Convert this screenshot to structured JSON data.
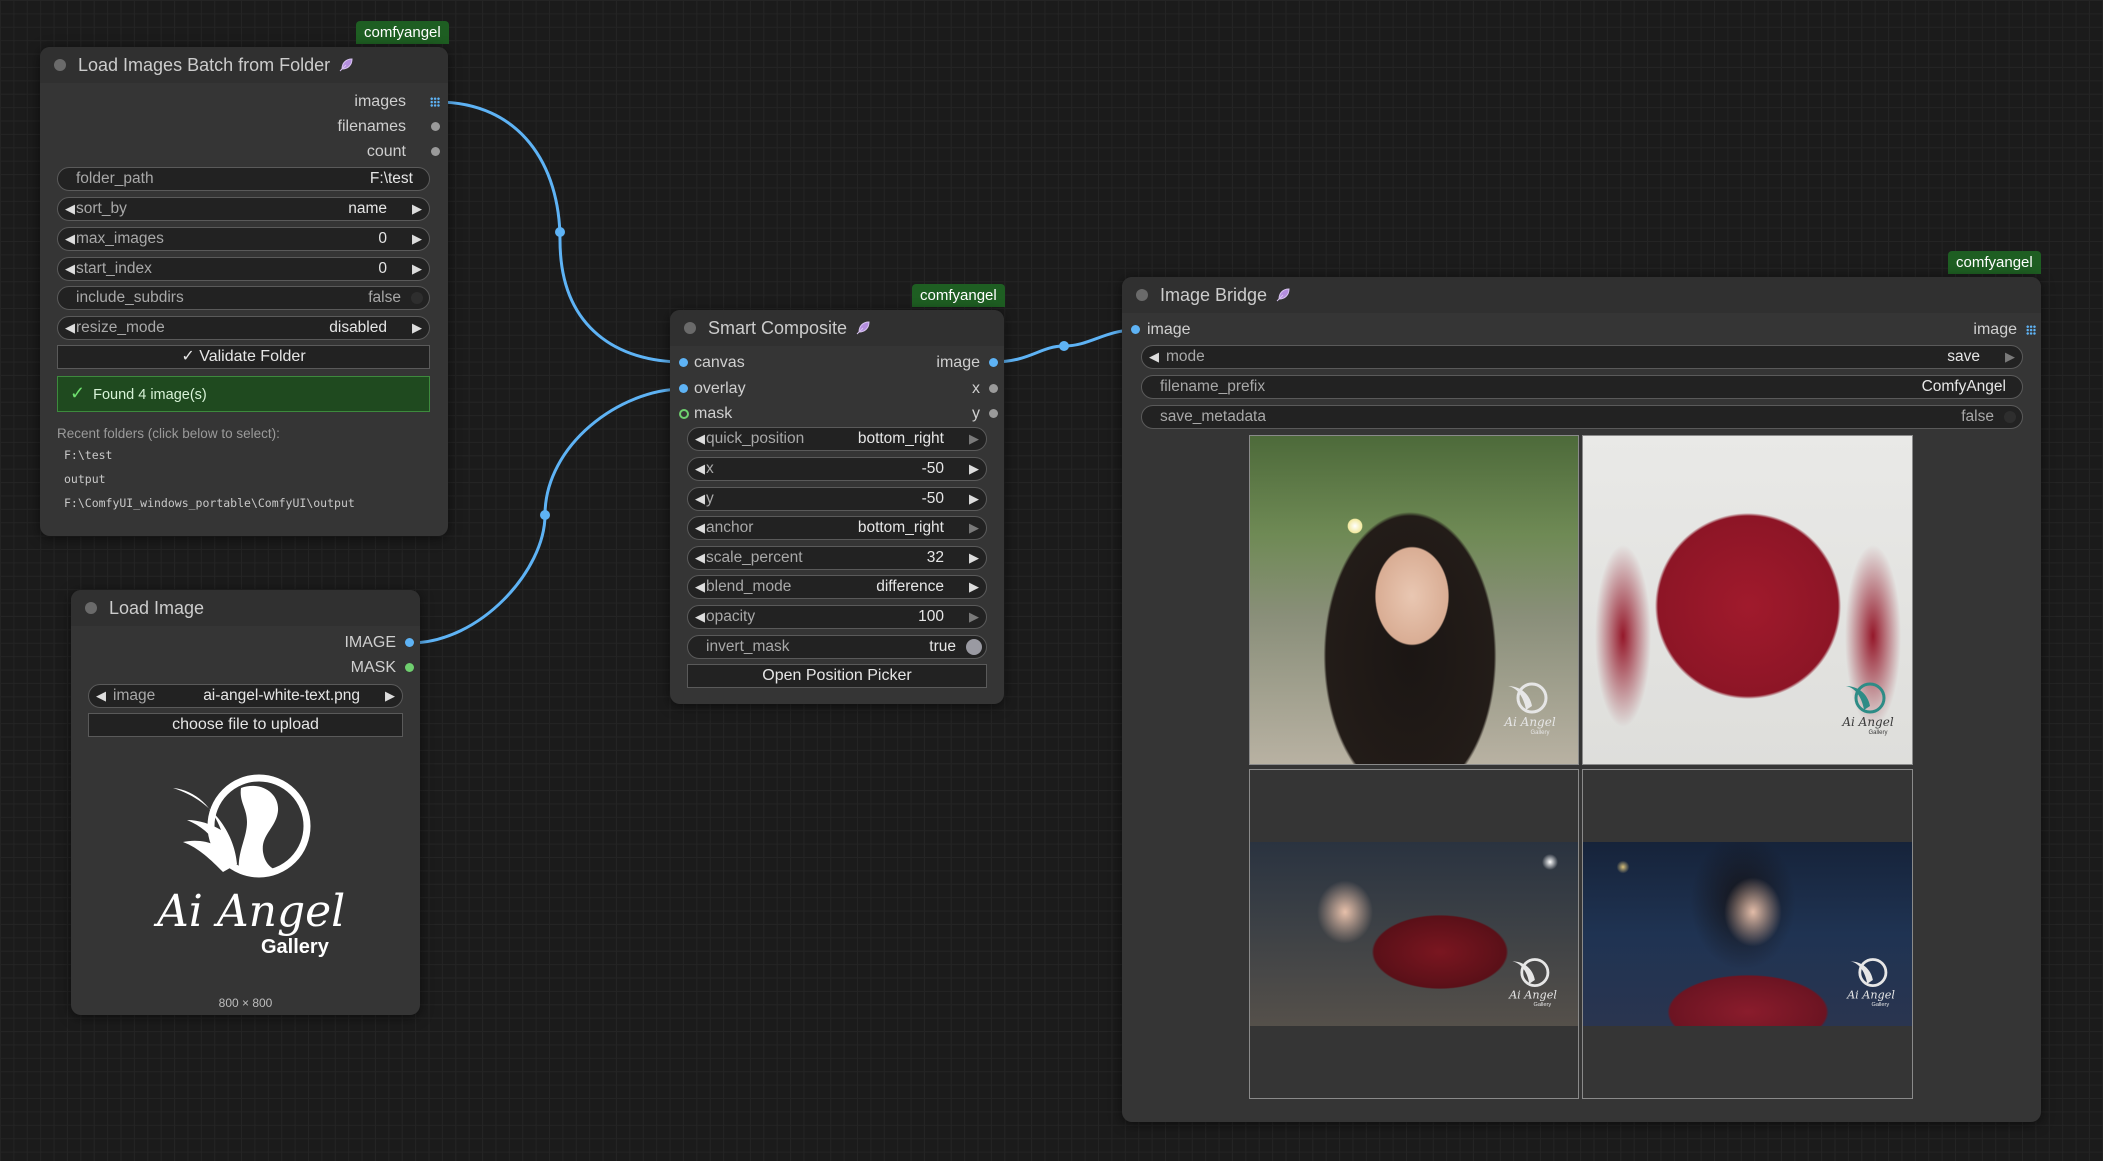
{
  "badges": {
    "node1": "comfyangel",
    "node2": "comfyangel",
    "node3": "comfyangel"
  },
  "load_batch": {
    "title": "Load Images Batch from Folder",
    "outputs": [
      "images",
      "filenames",
      "count"
    ],
    "widgets": {
      "folder_path": {
        "label": "folder_path",
        "value": "F:\\test"
      },
      "sort_by": {
        "label": "sort_by",
        "value": "name"
      },
      "max_images": {
        "label": "max_images",
        "value": "0"
      },
      "start_index": {
        "label": "start_index",
        "value": "0"
      },
      "include_subdirs": {
        "label": "include_subdirs",
        "value": "false"
      },
      "resize_mode": {
        "label": "resize_mode",
        "value": "disabled"
      }
    },
    "validate_button": "✓ Validate Folder",
    "found_text": "Found 4 image(s)",
    "recent_label": "Recent folders (click below to select):",
    "recent_folders": [
      "F:\\test",
      "output",
      "F:\\ComfyUI_windows_portable\\ComfyUI\\output"
    ]
  },
  "load_image": {
    "title": "Load Image",
    "outputs": [
      "IMAGE",
      "MASK"
    ],
    "image_widget": {
      "label": "image",
      "value": "ai-angel-white-text.png"
    },
    "upload_button": "choose file to upload",
    "logo_text": "Ai Angel",
    "logo_sub": "Gallery",
    "dimensions": "800 × 800"
  },
  "smart_composite": {
    "title": "Smart Composite",
    "inputs": [
      "canvas",
      "overlay",
      "mask"
    ],
    "outputs": [
      "image",
      "x",
      "y"
    ],
    "widgets": {
      "quick_position": {
        "label": "quick_position",
        "value": "bottom_right"
      },
      "x": {
        "label": "x",
        "value": "-50"
      },
      "y": {
        "label": "y",
        "value": "-50"
      },
      "anchor": {
        "label": "anchor",
        "value": "bottom_right"
      },
      "scale_percent": {
        "label": "scale_percent",
        "value": "32"
      },
      "blend_mode": {
        "label": "blend_mode",
        "value": "difference"
      },
      "opacity": {
        "label": "opacity",
        "value": "100"
      },
      "invert_mask": {
        "label": "invert_mask",
        "value": "true"
      }
    },
    "picker_button": "Open Position Picker"
  },
  "image_bridge": {
    "title": "Image Bridge",
    "input": "image",
    "output": "image",
    "widgets": {
      "mode": {
        "label": "mode",
        "value": "save"
      },
      "filename_prefix": {
        "label": "filename_prefix",
        "value": "ComfyAngel"
      },
      "save_metadata": {
        "label": "save_metadata",
        "value": "false"
      }
    },
    "watermark_text": "Ai Angel",
    "watermark_sub": "Gallery"
  },
  "colors": {
    "wire": "#5eb3f5",
    "badge": "#1e5e22",
    "node": "#353535",
    "canvas": "#1b1b1b"
  }
}
